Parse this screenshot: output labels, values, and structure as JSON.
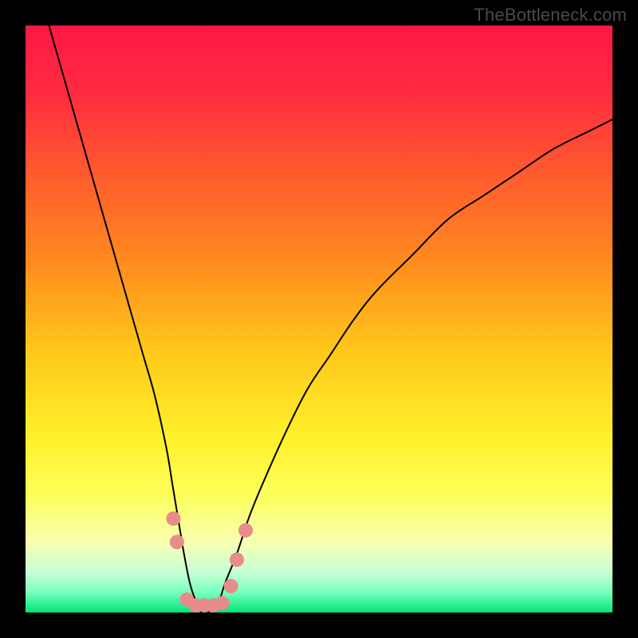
{
  "watermark": "TheBottleneck.com",
  "chart_data": {
    "type": "line",
    "title": "",
    "xlabel": "",
    "ylabel": "",
    "xlim": [
      0,
      100
    ],
    "ylim": [
      0,
      100
    ],
    "background_gradient": {
      "stops": [
        {
          "offset": 0.0,
          "color": "#ff1744"
        },
        {
          "offset": 0.12,
          "color": "#ff2d3f"
        },
        {
          "offset": 0.25,
          "color": "#ff5a2e"
        },
        {
          "offset": 0.4,
          "color": "#ff8a1e"
        },
        {
          "offset": 0.55,
          "color": "#ffc61a"
        },
        {
          "offset": 0.7,
          "color": "#fff02a"
        },
        {
          "offset": 0.8,
          "color": "#fdff5a"
        },
        {
          "offset": 0.88,
          "color": "#f7ffb0"
        },
        {
          "offset": 0.93,
          "color": "#c8ffd4"
        },
        {
          "offset": 0.965,
          "color": "#7affc0"
        },
        {
          "offset": 1.0,
          "color": "#00e676"
        }
      ]
    },
    "series": [
      {
        "name": "bottleneck-curve",
        "color": "#000000",
        "stroke_width": 2,
        "x": [
          4,
          6,
          8,
          10,
          12,
          14,
          16,
          18,
          20,
          22,
          24,
          25,
          26,
          27,
          28,
          29,
          30,
          31,
          32,
          33,
          34,
          36,
          38,
          40,
          44,
          48,
          52,
          56,
          60,
          66,
          72,
          78,
          84,
          90,
          96,
          100
        ],
        "y": [
          100,
          93,
          86,
          79,
          72,
          65,
          58,
          51,
          44,
          37,
          28,
          22,
          16,
          10,
          5,
          2,
          0,
          0,
          1,
          2,
          5,
          10,
          16,
          21,
          30,
          38,
          44,
          50,
          55,
          61,
          67,
          71,
          75,
          79,
          82,
          84
        ]
      }
    ],
    "markers": {
      "name": "valley-markers",
      "color": "#e78b8b",
      "radius": 9,
      "points": [
        {
          "x": 25.2,
          "y": 16
        },
        {
          "x": 25.8,
          "y": 12
        },
        {
          "x": 27.5,
          "y": 2.2
        },
        {
          "x": 29.0,
          "y": 1.2
        },
        {
          "x": 30.5,
          "y": 1.2
        },
        {
          "x": 32.0,
          "y": 1.2
        },
        {
          "x": 33.5,
          "y": 1.6
        },
        {
          "x": 35.0,
          "y": 4.5
        },
        {
          "x": 36.0,
          "y": 9.0
        },
        {
          "x": 37.5,
          "y": 14.0
        }
      ]
    }
  }
}
